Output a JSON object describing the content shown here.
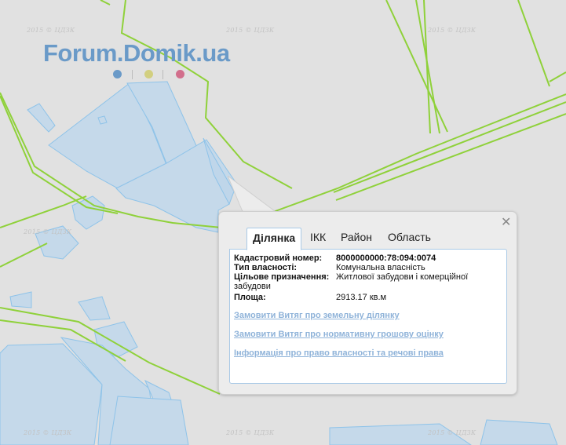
{
  "logo": {
    "text": "Forum.Domik.ua",
    "dot_colors": [
      "#6a9ac8",
      "#d2cf80",
      "#d26f8c"
    ]
  },
  "watermark": "2015 © ЦДЗК",
  "colors": {
    "background": "#e1e1e1",
    "road_line": "#8fd13a",
    "parcel_fill": "#c5d9ea",
    "parcel_stroke": "#8ec3e9",
    "link": "#8fb3d9"
  },
  "popup": {
    "close_glyph": "✕",
    "tabs": [
      {
        "label": "Ділянка",
        "active": true
      },
      {
        "label": "ІКК",
        "active": false
      },
      {
        "label": "Район",
        "active": false
      },
      {
        "label": "Область",
        "active": false
      }
    ],
    "fields": {
      "cadastral_label": "Кадастровий номер:",
      "cadastral_value": "8000000000:78:094:0074",
      "ownership_label": "Тип власності:",
      "ownership_value": "Комунальна власність",
      "purpose_label": "Цільове призначення:",
      "purpose_value": "Житлової забудови і комерційної",
      "purpose_value_cont": "забудови",
      "area_label": "Площа:",
      "area_value": "2913.17 кв.м"
    },
    "links": [
      "Замовити Витяг про земельну ділянку",
      "Замовити Витяг про нормативну грошову оцінку",
      "Інформація про право власності та речові права"
    ]
  }
}
